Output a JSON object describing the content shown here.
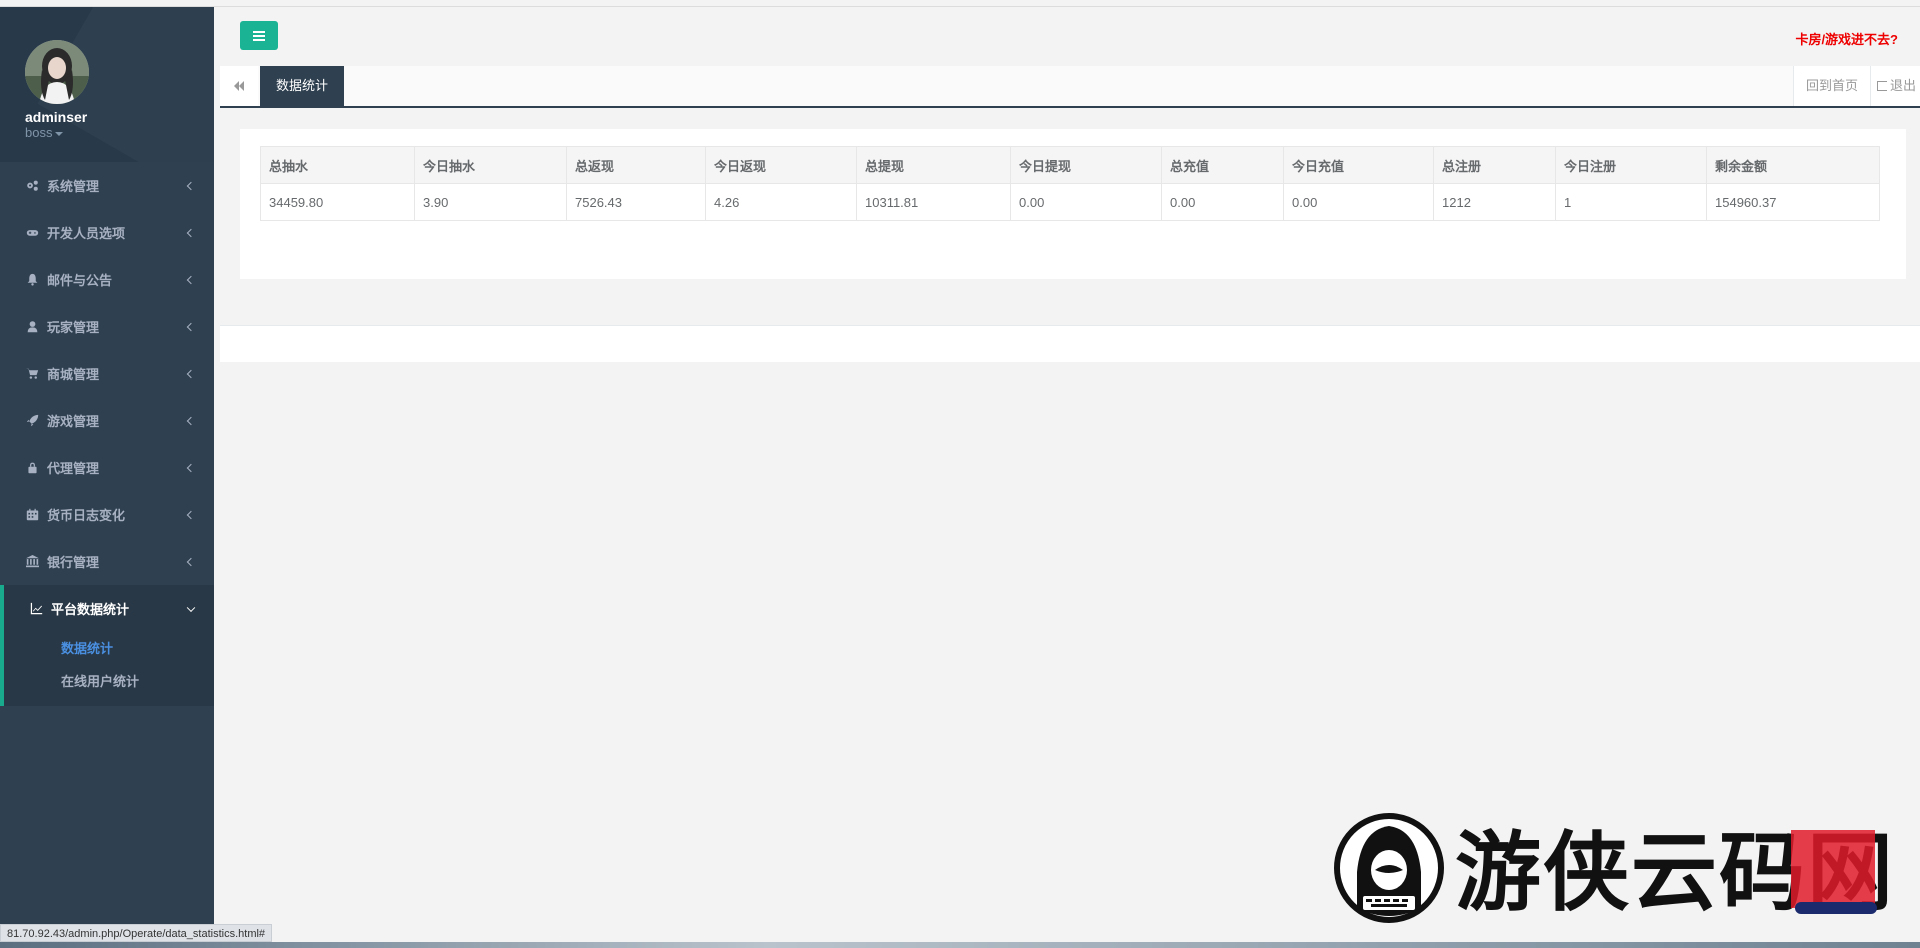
{
  "user": {
    "name": "adminser",
    "role": "boss"
  },
  "sidebar": {
    "items": [
      {
        "label": "系统管理",
        "icon": "cogs-icon"
      },
      {
        "label": "开发人员选项",
        "icon": "gamepad-icon"
      },
      {
        "label": "邮件与公告",
        "icon": "bell-icon"
      },
      {
        "label": "玩家管理",
        "icon": "user-icon"
      },
      {
        "label": "商城管理",
        "icon": "cart-icon"
      },
      {
        "label": "游戏管理",
        "icon": "rocket-icon"
      },
      {
        "label": "代理管理",
        "icon": "lock-icon"
      },
      {
        "label": "货币日志变化",
        "icon": "calendar-icon"
      },
      {
        "label": "银行管理",
        "icon": "bank-icon"
      }
    ],
    "active": {
      "label": "平台数据统计",
      "icon": "line-chart-icon",
      "sub": [
        "数据统计",
        "在线用户统计"
      ]
    }
  },
  "header": {
    "notice": "卡房/游戏进不去?"
  },
  "tabs": {
    "current": "数据统计",
    "home": "回到首页",
    "logout": "退出"
  },
  "table": {
    "headers": [
      "总抽水",
      "今日抽水",
      "总返现",
      "今日返现",
      "总提现",
      "今日提现",
      "总充值",
      "今日充值",
      "总注册",
      "今日注册",
      "剩余金额"
    ],
    "rows": [
      [
        "34459.80",
        "3.90",
        "7526.43",
        "4.26",
        "10311.81",
        "0.00",
        "0.00",
        "0.00",
        "1212",
        "1",
        "154960.37"
      ]
    ]
  },
  "status_url": "81.70.92.43/admin.php/Operate/data_statistics.html#",
  "watermark": {
    "text": "游侠云码网"
  },
  "colors": {
    "sidebar": "#2f4050",
    "accent": "#1ab394",
    "notice": "#ee0000",
    "link_active": "#4a90e2"
  }
}
